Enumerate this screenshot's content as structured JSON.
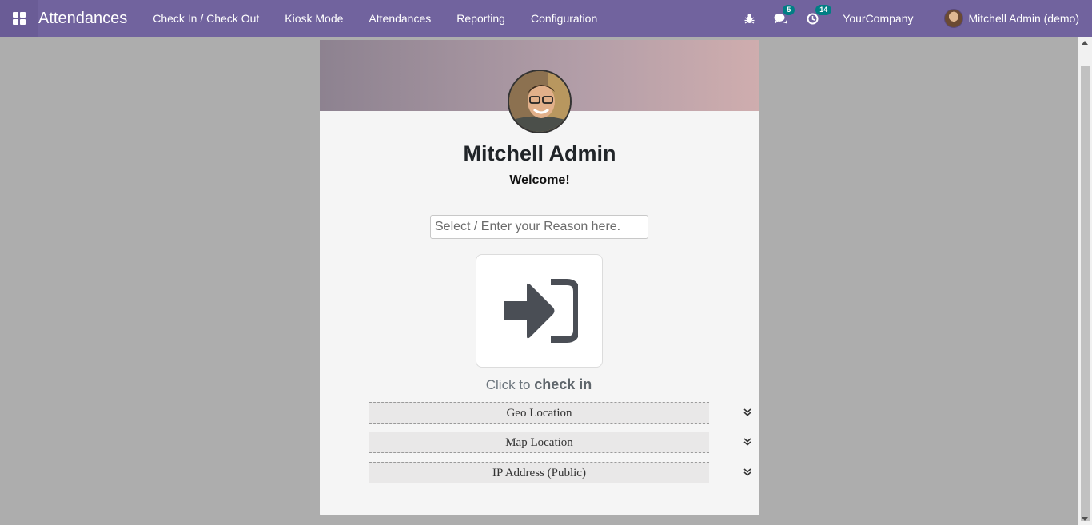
{
  "navbar": {
    "app_title": "Attendances",
    "menu": [
      "Check In / Check Out",
      "Kiosk Mode",
      "Attendances",
      "Reporting",
      "Configuration"
    ],
    "messages_count": "5",
    "activities_count": "14",
    "company": "YourCompany",
    "user": "Mitchell Admin (demo)",
    "accent_color": "#71639e"
  },
  "card": {
    "employee_name": "Mitchell Admin",
    "greeting": "Welcome!",
    "reason_placeholder": "Select / Enter your Reason here.",
    "click_prefix": "Click to",
    "click_action": "check in",
    "sections": [
      "Geo Location",
      "Map Location",
      "IP Address (Public)"
    ]
  }
}
